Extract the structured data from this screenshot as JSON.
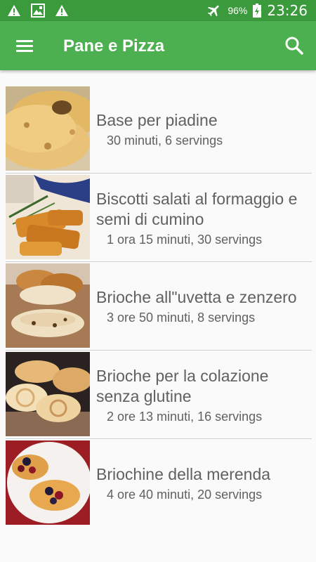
{
  "status_bar": {
    "icons_left": [
      "warning-icon",
      "image-icon",
      "warning-icon"
    ],
    "battery": "96%",
    "time": "23:26"
  },
  "app_bar": {
    "title": "Pane e Pizza",
    "background": "#4caf50",
    "status_background": "#3a9a3c"
  },
  "recipes": [
    {
      "title": "Base per piadine",
      "meta": "30 minuti, 6 servings",
      "image": "piadine-photo"
    },
    {
      "title": "Biscotti salati al formaggio e semi di cumino",
      "meta": "1 ora 15 minuti, 30 servings",
      "image": "biscotti-photo"
    },
    {
      "title": "Brioche all\"uvetta e zenzero",
      "meta": "3 ore 50 minuti, 8 servings",
      "image": "brioche-uvetta-photo"
    },
    {
      "title": "Brioche per la colazione senza glutine",
      "meta": "2 ore 13 minuti, 16 servings",
      "image": "brioche-colazione-photo"
    },
    {
      "title": "Briochine della merenda",
      "meta": "4 ore 40 minuti, 20 servings",
      "image": "briochine-photo"
    }
  ]
}
